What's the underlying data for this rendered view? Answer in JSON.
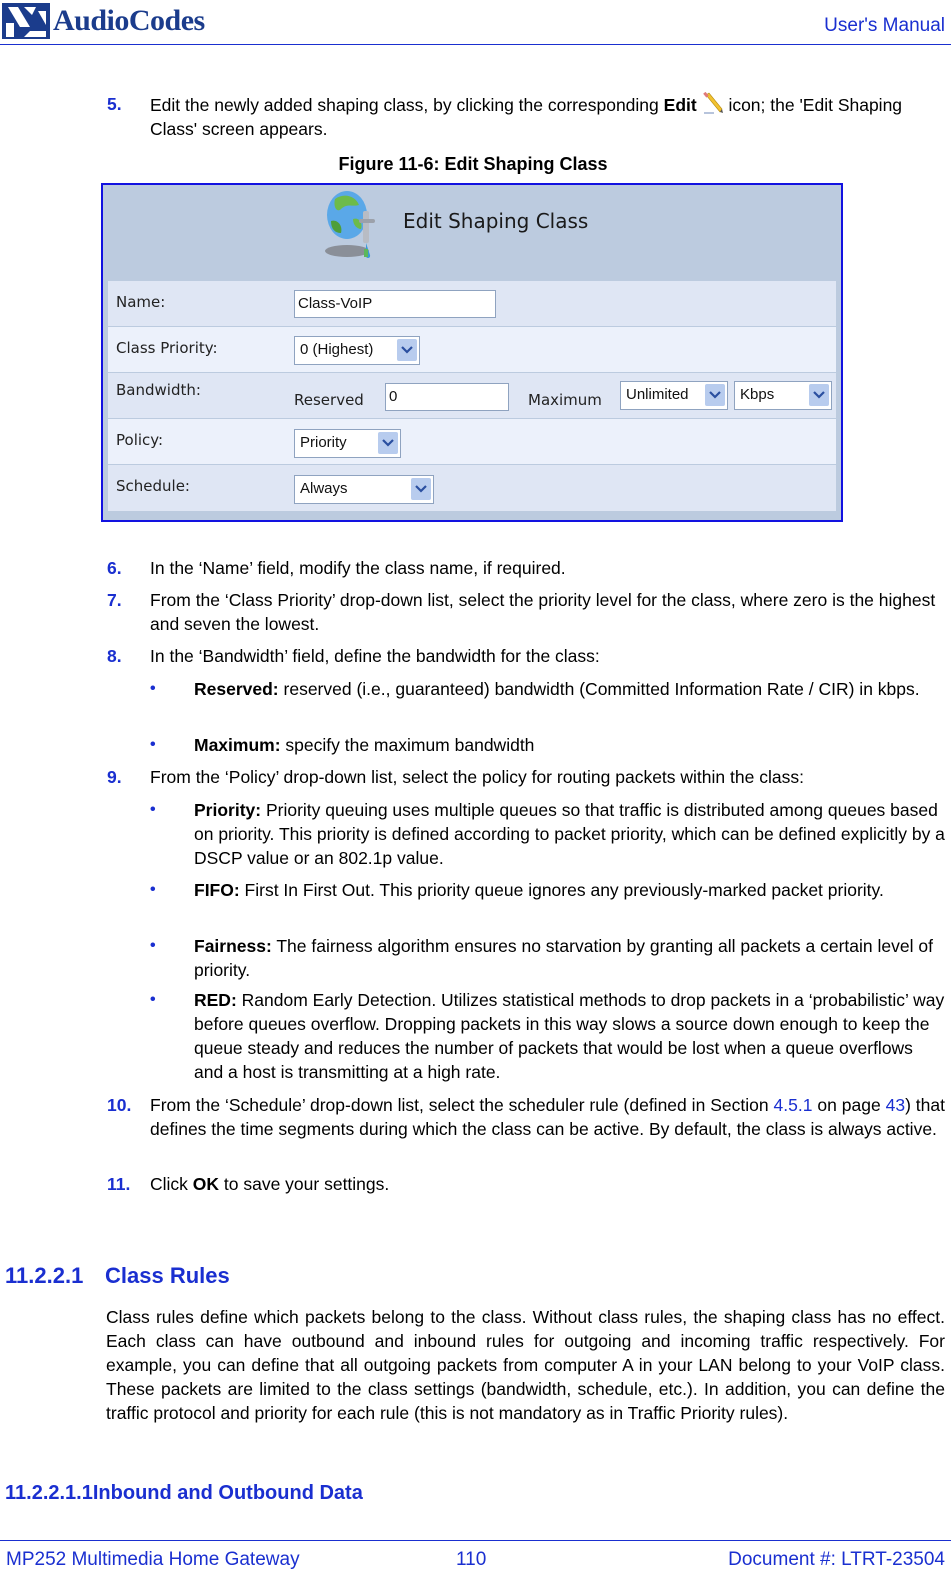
{
  "header": {
    "brand": "AudioCodes",
    "doc_type": "User's Manual"
  },
  "steps_top": [
    {
      "num": "5.",
      "pre": "Edit the newly added shaping class, by clicking the corresponding ",
      "bold": "Edit",
      "post": " icon; the 'Edit Shaping Class' screen appears."
    }
  ],
  "figure": {
    "caption": "Figure 11-6: Edit Shaping Class",
    "screen_title": "Edit Shaping Class",
    "fields": {
      "name_label": "Name:",
      "name_value": "Class-VoIP",
      "priority_label": "Class Priority:",
      "priority_value": "0 (Highest)",
      "bandwidth_label": "Bandwidth:",
      "reserved_label": "Reserved",
      "reserved_value": "0",
      "maximum_label": "Maximum",
      "maximum_value": "Unlimited",
      "unit_value": "Kbps",
      "policy_label": "Policy:",
      "policy_value": "Priority",
      "schedule_label": "Schedule:",
      "schedule_value": "Always"
    }
  },
  "steps": {
    "s6": {
      "num": "6.",
      "text": "In the ‘Name’ field, modify the class name, if required."
    },
    "s7": {
      "num": "7.",
      "text": "From the ‘Class Priority’ drop-down list, select the priority level for the class, where zero is the highest and seven the lowest."
    },
    "s8": {
      "num": "8.",
      "text": "In the ‘Bandwidth’ field, define the bandwidth for the class:"
    },
    "s8_bullets": [
      {
        "bold": "Reserved:",
        "text": " reserved (i.e., guaranteed) bandwidth (Committed Information Rate / CIR) in kbps."
      },
      {
        "bold": "Maximum:",
        "text": " specify the maximum bandwidth"
      }
    ],
    "s9": {
      "num": "9.",
      "text": "From the ‘Policy’ drop-down list, select the policy for routing packets within the class:"
    },
    "s9_bullets": [
      {
        "bold": "Priority:",
        "text": " Priority queuing uses multiple queues so that traffic is distributed among queues based on priority. This priority is defined according to packet priority, which can be defined explicitly by a DSCP value or an 802.1p value."
      },
      {
        "bold": "FIFO:",
        "text": " First In First Out. This priority queue ignores any previously-marked packet priority."
      },
      {
        "bold": "Fairness:",
        "text": " The fairness algorithm ensures no starvation by granting all packets a certain level of priority."
      },
      {
        "bold": "RED:",
        "text": " Random Early Detection. Utilizes statistical methods to drop packets in a ‘probabilistic’ way before queues overflow. Dropping packets in this way slows a source down enough to keep the queue steady and reduces the number of packets that would be lost when a queue overflows and a host is transmitting at a high rate."
      }
    ],
    "s10": {
      "num": "10.",
      "pre": "From the ‘Schedule’ drop-down list, select the scheduler rule (defined in Section ",
      "link1": "4.5.1",
      "mid": " on page ",
      "link2": "43",
      "post": ") that defines the time segments during which the class can be active. By default, the class is always active."
    },
    "s11": {
      "num": "11.",
      "pre": "Click ",
      "bold": "OK",
      "post": " to save your settings."
    }
  },
  "section": {
    "num": "11.2.2.1",
    "title": "Class Rules",
    "body": "Class rules define which packets belong to the class. Without class rules, the shaping class has no effect. Each class can have outbound and inbound rules for outgoing and incoming traffic respectively. For example, you can define that all outgoing packets from computer A in your LAN belong to your VoIP class. These packets are limited to the class settings (bandwidth, schedule, etc.). In addition, you can define the traffic protocol and priority for each rule (this is not mandatory as in Traffic Priority rules).",
    "sub_num": "11.2.2.1.1",
    "sub_title": "Inbound and Outbound Data"
  },
  "footer": {
    "product": "MP252 Multimedia Home Gateway",
    "page": "110",
    "doc_num": "Document #: LTRT-23504"
  },
  "colors": {
    "accent": "#1a2fd0",
    "brand": "#1b3c8c",
    "figure_border": "#1212e0",
    "figure_bg": "#bccbdf"
  }
}
